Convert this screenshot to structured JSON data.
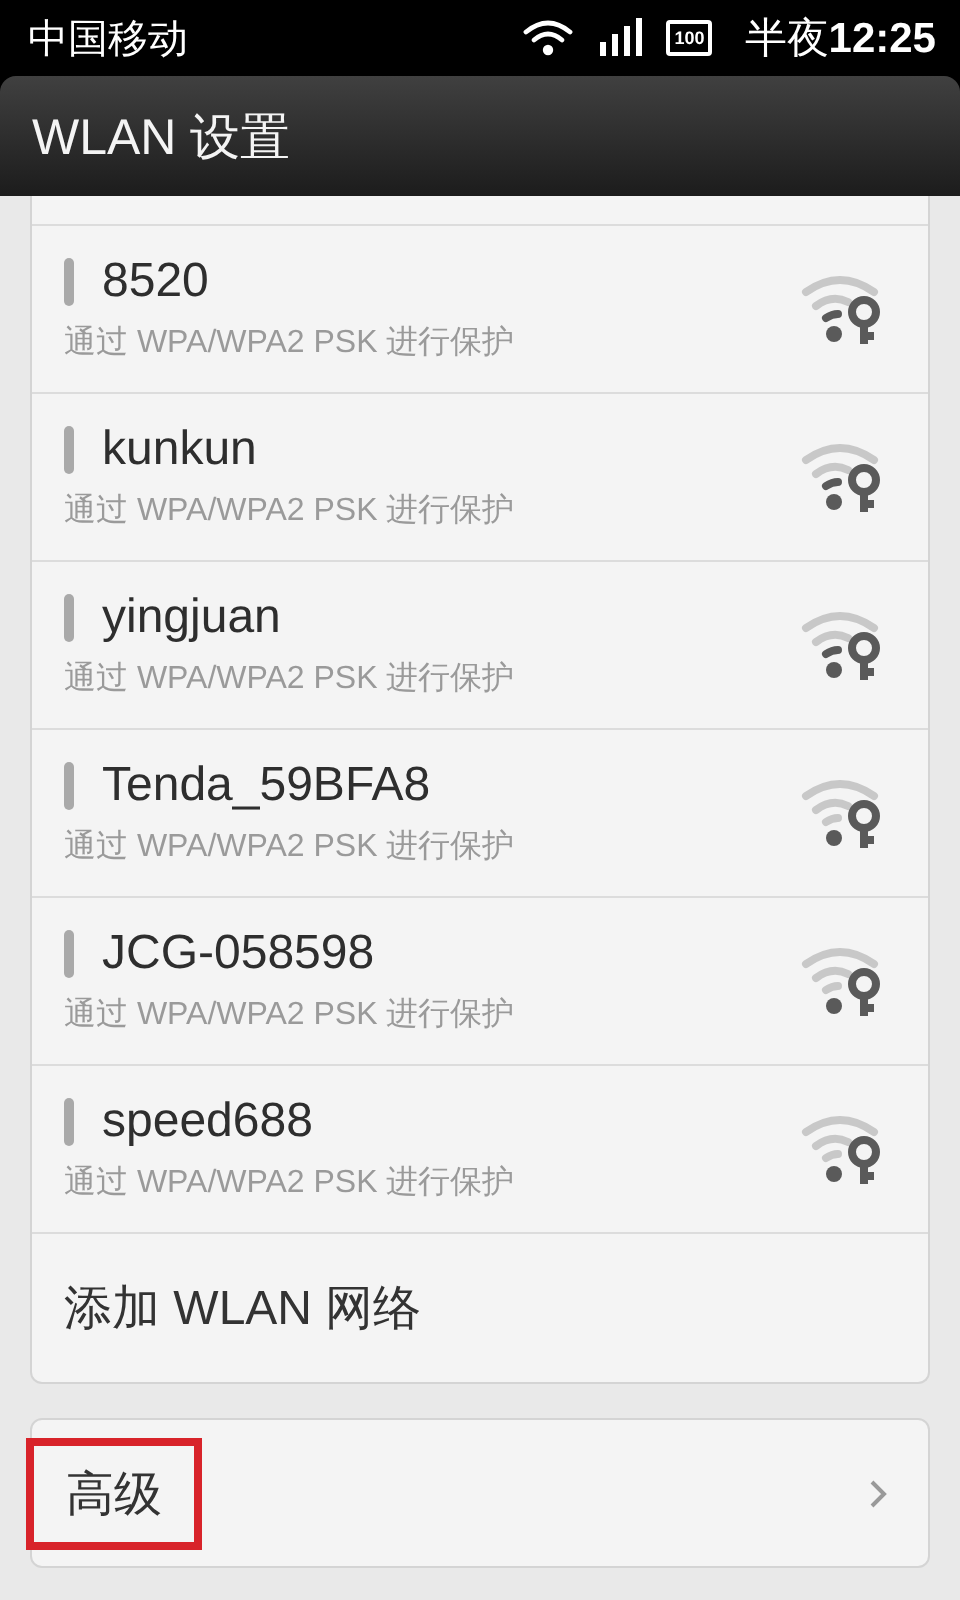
{
  "status_bar": {
    "carrier": "中国移动",
    "battery_text": "100",
    "time": "半夜**12:25**"
  },
  "title_bar": {
    "title": "WLAN 设置"
  },
  "networks": [
    {
      "name": "8520",
      "security": "通过 WPA/WPA2 PSK 进行保护",
      "kind": "fair"
    },
    {
      "name": "kunkun",
      "security": "通过 WPA/WPA2 PSK 进行保护",
      "kind": "fair"
    },
    {
      "name": "yingjuan",
      "security": "通过 WPA/WPA2 PSK 进行保护",
      "kind": "fair"
    },
    {
      "name": "Tenda_59BFA8",
      "security": "通过 WPA/WPA2 PSK 进行保护",
      "kind": "weak"
    },
    {
      "name": "JCG-058598",
      "security": "通过 WPA/WPA2 PSK 进行保护",
      "kind": "weak"
    },
    {
      "name": "speed688",
      "security": "通过 WPA/WPA2 PSK 进行保护",
      "kind": "weak"
    }
  ],
  "add_network": {
    "label": "添加 WLAN 网络"
  },
  "advanced": {
    "label": "高级",
    "highlighted": true
  }
}
